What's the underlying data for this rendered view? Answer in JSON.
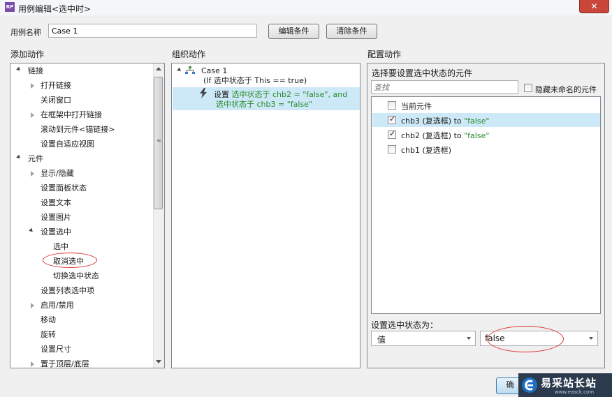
{
  "window": {
    "title": "用例编辑<选中时>",
    "app_icon_text": "RP",
    "close_label": "✕"
  },
  "case_name": {
    "label": "用例名称",
    "value": "Case 1"
  },
  "buttons": {
    "edit_condition": "编辑条件",
    "clear_condition": "清除条件",
    "ok_partial": "确"
  },
  "sections": {
    "add": "添加动作",
    "organize": "组织动作",
    "configure": "配置动作"
  },
  "add_tree": [
    "链接",
    "打开链接",
    "关闭窗口",
    "在框架中打开链接",
    "滚动到元件<锚链接>",
    "设置自适应视图",
    "元件",
    "显示/隐藏",
    "设置面板状态",
    "设置文本",
    "设置图片",
    "设置选中",
    "选中",
    "取消选中",
    "切换选中状态",
    "设置列表选中项",
    "启用/禁用",
    "移动",
    "旋转",
    "设置尺寸",
    "置于顶层/底层"
  ],
  "organize": {
    "case_title": "Case 1",
    "condition": "(If 选中状态于 This == true)",
    "action_prefix": "设置",
    "action_line1": "选中状态于 chb2 = \"false\", and",
    "action_line2": "选中状态于 chb3 = \"false\""
  },
  "configure": {
    "select_label": "选择要设置选中状态的元件",
    "search_placeholder": "查找",
    "hide_unnamed": "隐藏未命名的元件",
    "items": [
      {
        "name": "当前元件",
        "checked": false,
        "suffix": ""
      },
      {
        "name": "chb3 (复选框) to",
        "checked": true,
        "suffix": "\"false\""
      },
      {
        "name": "chb2 (复选框) to",
        "checked": true,
        "suffix": "\"false\""
      },
      {
        "name": "chb1 (复选框)",
        "checked": false,
        "suffix": ""
      }
    ],
    "state_label": "设置选中状态为：",
    "mode_value": "值",
    "state_value": "false"
  },
  "watermark": {
    "brand": "易采站长站",
    "sub": "www.easck.com"
  },
  "colors": {
    "highlight": "#cde9f7",
    "green_text": "#2a8a2a",
    "annotation_red": "#e03030"
  }
}
